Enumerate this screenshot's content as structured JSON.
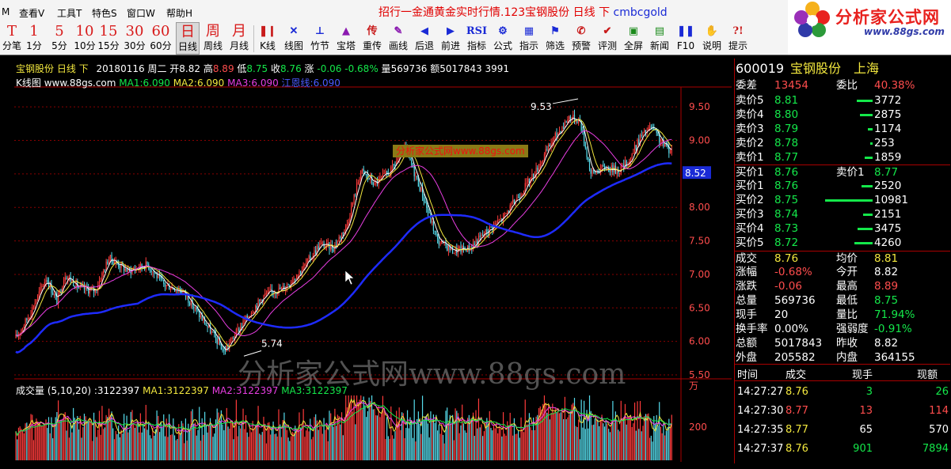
{
  "menu": [
    "M",
    "查看V",
    "工具T",
    "特色S",
    "窗口W",
    "帮助H"
  ],
  "marquee": {
    "text": "招行一金通黄金实时行情.123宝钢股份 日线 下",
    "code": "cmbcgold"
  },
  "logo": {
    "title": "分析家公式网",
    "url": "www.88gs.com"
  },
  "toolbar": {
    "periods": [
      {
        "glyph": "T",
        "label": "分笔"
      },
      {
        "glyph": "1",
        "label": "1分"
      },
      {
        "glyph": "5",
        "label": "5分"
      },
      {
        "glyph": "10",
        "label": "10分"
      },
      {
        "glyph": "15",
        "label": "15分"
      },
      {
        "glyph": "30",
        "label": "30分"
      },
      {
        "glyph": "60",
        "label": "60分"
      },
      {
        "glyph": "日",
        "label": "日线"
      },
      {
        "glyph": "周",
        "label": "周线"
      },
      {
        "glyph": "月",
        "label": "月线"
      }
    ],
    "tools": [
      "K线",
      "线图",
      "竹节",
      "宝塔",
      "重传",
      "画线",
      "后退",
      "前进",
      "指标",
      "公式",
      "指示",
      "筛选",
      "预警",
      "评测",
      "全屏",
      "新闻",
      "F10",
      "说明",
      "提示"
    ],
    "tool_glyphs": [
      "❚❙",
      "✕",
      "⊥",
      "▲",
      "传",
      "✎",
      "◀",
      "▶",
      "RSI",
      "⚙",
      "▦",
      "⚑",
      "✆",
      "✔",
      "▣",
      "▤",
      "❚❚",
      "✋",
      "?!"
    ],
    "hidden_glyph_label": ""
  },
  "kchart": {
    "info": {
      "name": "宝钢股份",
      "period": "日线",
      "dir": "下",
      "date": "20180116",
      "weekday": "周二",
      "open_lbl": "开",
      "open": "8.82",
      "high_lbl": "高",
      "high": "8.89",
      "low_lbl": "低",
      "low": "8.75",
      "close_lbl": "收",
      "close": "8.76",
      "chg_lbl": "涨",
      "chg": "-0.06",
      "pct": "-0.68%",
      "vol_lbl": "量",
      "vol": "569736",
      "amt_lbl": "额",
      "amt": "5017843",
      "extra": "3991"
    },
    "title": "K线图",
    "site": "www.88gs.com",
    "ma1": "MA1:6.090",
    "ma2": "MA2:6.090",
    "ma3": "MA3:6.090",
    "ma4": "江恩线:6.090",
    "price_labels": [
      "9.50",
      "9.00",
      "8.50",
      "8.00",
      "7.50",
      "7.00",
      "6.50",
      "6.00",
      "5.50"
    ],
    "current_price": "8.52",
    "high_mark": "9.53",
    "low_mark": "5.74",
    "banner": "分析家公式网www.88gs.com",
    "watermark": "分析家公式网www.88gs.com",
    "colors": {
      "ma1": "#ffffff",
      "ma2": "#f2e73e",
      "ma3": "#e83ee2",
      "gann": "#1e2bff",
      "up": "#ff3b3b",
      "down": "#56dcec"
    }
  },
  "volume": {
    "title": "成交量",
    "params": "(5,10,20)",
    "value": ":3122397",
    "ma1": "MA1:3122397",
    "ma2": "MA2:3122397",
    "ma3": "MA3:3122397",
    "unit": "万",
    "label": "200"
  },
  "quote": {
    "code": "600019",
    "name": "宝钢股份",
    "market": "上海",
    "weicha": {
      "label": "委差",
      "value": "13454"
    },
    "weibi": {
      "label": "委比",
      "value": "40.38%"
    },
    "asks": [
      {
        "label": "卖价5",
        "price": "8.81",
        "vol": "3772",
        "bar": 0.34
      },
      {
        "label": "卖价4",
        "price": "8.80",
        "vol": "2875",
        "bar": 0.26
      },
      {
        "label": "卖价3",
        "price": "8.79",
        "vol": "1174",
        "bar": 0.1
      },
      {
        "label": "卖价2",
        "price": "8.78",
        "vol": "253",
        "bar": 0.03
      },
      {
        "label": "卖价1",
        "price": "8.77",
        "vol": "1859",
        "bar": 0.17
      }
    ],
    "bid_header": {
      "l1": "买价1",
      "v1": "8.76",
      "l2": "卖价1",
      "v2": "8.77"
    },
    "bids": [
      {
        "label": "买价1",
        "price": "8.76",
        "vol": "2520",
        "bar": 0.23
      },
      {
        "label": "买价2",
        "price": "8.75",
        "vol": "10981",
        "bar": 1.0
      },
      {
        "label": "买价3",
        "price": "8.74",
        "vol": "2151",
        "bar": 0.2
      },
      {
        "label": "买价4",
        "price": "8.73",
        "vol": "3475",
        "bar": 0.32
      },
      {
        "label": "买价5",
        "price": "8.72",
        "vol": "4260",
        "bar": 0.39
      }
    ],
    "stats": [
      {
        "l1": "成交",
        "v1": "8.76",
        "l2": "均价",
        "v2": "8.81"
      },
      {
        "l1": "涨幅",
        "v1": "-0.68%",
        "l2": "今开",
        "v2": "8.82"
      },
      {
        "l1": "涨跌",
        "v1": "-0.06",
        "l2": "最高",
        "v2": "8.89"
      },
      {
        "l1": "总量",
        "v1": "569736",
        "l2": "最低",
        "v2": "8.75"
      },
      {
        "l1": "现手",
        "v1": "20",
        "l2": "量比",
        "v2": "71.94%"
      },
      {
        "l1": "换手率",
        "v1": "0.00%",
        "l2": "强弱度",
        "v2": "-0.91%"
      },
      {
        "l1": "总额",
        "v1": "5017843",
        "l2": "昨收",
        "v2": "8.82"
      },
      {
        "l1": "外盘",
        "v1": "205582",
        "l2": "内盘",
        "v2": "364155"
      }
    ],
    "tick_headers": [
      "时间",
      "成交",
      "现手",
      "现额"
    ],
    "ticks": [
      {
        "time": "14:27:27",
        "price": "8.76",
        "hand": "3",
        "amt": "26"
      },
      {
        "time": "14:27:30",
        "price": "8.77",
        "hand": "13",
        "amt": "114"
      },
      {
        "time": "14:27:35",
        "price": "8.77",
        "hand": "65",
        "amt": "570"
      },
      {
        "time": "14:27:37",
        "price": "8.76",
        "hand": "901",
        "amt": "7894"
      }
    ]
  }
}
